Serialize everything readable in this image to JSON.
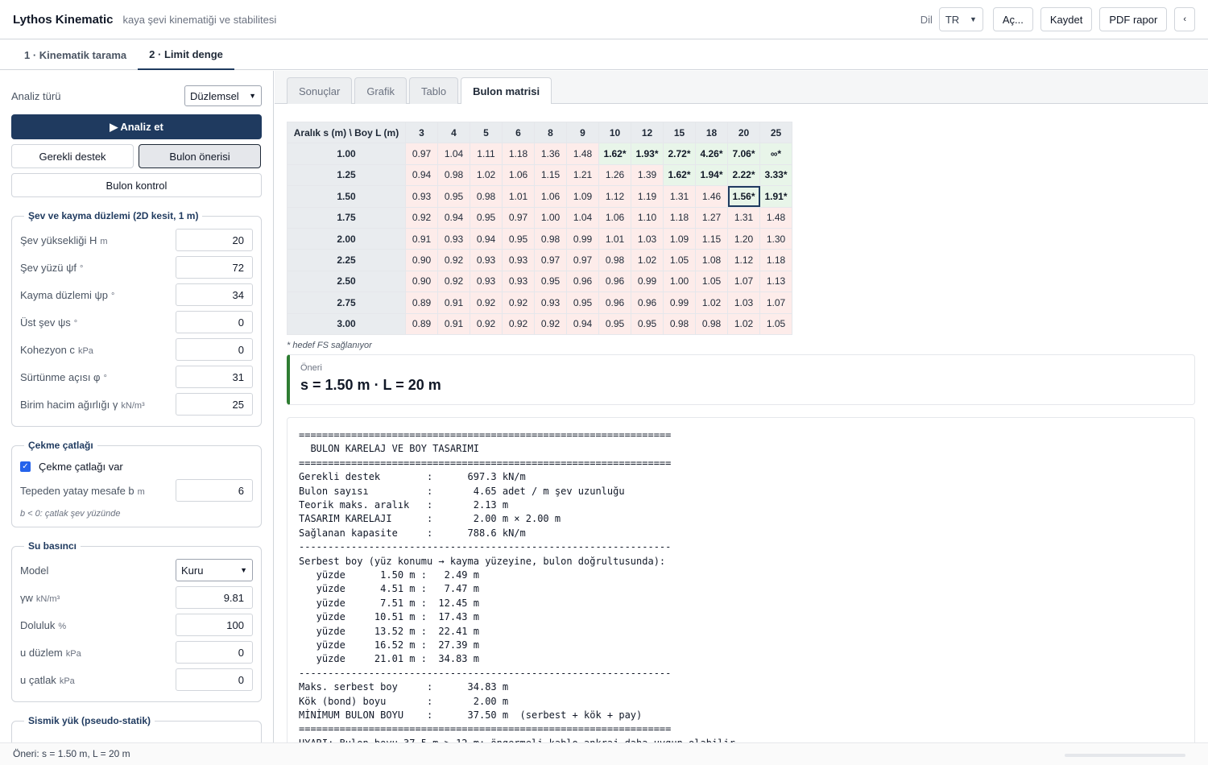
{
  "app": {
    "title": "Lythos Kinematic",
    "subtitle": "kaya şevi kinematiği ve stabilitesi"
  },
  "topbar": {
    "dil_label": "Dil",
    "lang": "TR",
    "open": "Aç...",
    "save": "Kaydet",
    "pdf": "PDF rapor",
    "collapse": "‹"
  },
  "main_tabs": [
    "1 · Kinematik tarama",
    "2 · Limit denge"
  ],
  "sidebar": {
    "analiz_label": "Analiz türü",
    "analiz_value": "Düzlemsel",
    "analyze_btn": "▶ Analiz et",
    "btn_destek": "Gerekli destek",
    "btn_bulon_oneri": "Bulon önerisi",
    "btn_bulon_kontrol": "Bulon kontrol",
    "sev": {
      "legend": "Şev ve kayma düzlemi (2D kesit, 1 m)",
      "fields": [
        {
          "label": "Şev yüksekliği H",
          "unit": "m",
          "value": "20"
        },
        {
          "label": "Şev yüzü ψf",
          "unit": "°",
          "value": "72"
        },
        {
          "label": "Kayma düzlemi ψp",
          "unit": "°",
          "value": "34"
        },
        {
          "label": "Üst şev ψs",
          "unit": "°",
          "value": "0"
        },
        {
          "label": "Kohezyon c",
          "unit": "kPa",
          "value": "0"
        },
        {
          "label": "Sürtünme açısı φ",
          "unit": "°",
          "value": "31"
        },
        {
          "label": "Birim hacim ağırlığı γ",
          "unit": "kN/m³",
          "value": "25"
        }
      ]
    },
    "catlak": {
      "legend": "Çekme çatlağı",
      "checkbox_label": "Çekme çatlağı var",
      "field": {
        "label": "Tepeden yatay mesafe b",
        "unit": "m",
        "value": "6"
      },
      "note": "b < 0: çatlak şev yüzünde"
    },
    "su": {
      "legend": "Su basıncı",
      "model_label": "Model",
      "model_value": "Kuru",
      "fields": [
        {
          "label": "γw",
          "unit": "kN/m³",
          "value": "9.81"
        },
        {
          "label": "Doluluk",
          "unit": "%",
          "value": "100"
        },
        {
          "label": "u düzlem",
          "unit": "kPa",
          "value": "0"
        },
        {
          "label": "u çatlak",
          "unit": "kPa",
          "value": "0"
        }
      ]
    },
    "sismik": {
      "legend": "Sismik yük (pseudo-statik)"
    }
  },
  "sub_tabs": [
    "Sonuçlar",
    "Grafik",
    "Tablo",
    "Bulon matrisi"
  ],
  "matrix": {
    "corner": "Aralık s (m) \\ Boy L (m)",
    "cols": [
      "3",
      "4",
      "5",
      "6",
      "8",
      "9",
      "10",
      "12",
      "15",
      "18",
      "20",
      "25"
    ],
    "rows": [
      {
        "s": "1.00",
        "cells": [
          "0.97",
          "1.04",
          "1.11",
          "1.18",
          "1.36",
          "1.48",
          "1.62*",
          "1.93*",
          "2.72*",
          "4.26*",
          "7.06*",
          "∞*"
        ]
      },
      {
        "s": "1.25",
        "cells": [
          "0.94",
          "0.98",
          "1.02",
          "1.06",
          "1.15",
          "1.21",
          "1.26",
          "1.39",
          "1.62*",
          "1.94*",
          "2.22*",
          "3.33*"
        ]
      },
      {
        "s": "1.50",
        "cells": [
          "0.93",
          "0.95",
          "0.98",
          "1.01",
          "1.06",
          "1.09",
          "1.12",
          "1.19",
          "1.31",
          "1.46",
          "1.56*",
          "1.91*"
        ]
      },
      {
        "s": "1.75",
        "cells": [
          "0.92",
          "0.94",
          "0.95",
          "0.97",
          "1.00",
          "1.04",
          "1.06",
          "1.10",
          "1.18",
          "1.27",
          "1.31",
          "1.48"
        ]
      },
      {
        "s": "2.00",
        "cells": [
          "0.91",
          "0.93",
          "0.94",
          "0.95",
          "0.98",
          "0.99",
          "1.01",
          "1.03",
          "1.09",
          "1.15",
          "1.20",
          "1.30"
        ]
      },
      {
        "s": "2.25",
        "cells": [
          "0.90",
          "0.92",
          "0.93",
          "0.93",
          "0.97",
          "0.97",
          "0.98",
          "1.02",
          "1.05",
          "1.08",
          "1.12",
          "1.18"
        ]
      },
      {
        "s": "2.50",
        "cells": [
          "0.90",
          "0.92",
          "0.93",
          "0.93",
          "0.95",
          "0.96",
          "0.96",
          "0.99",
          "1.00",
          "1.05",
          "1.07",
          "1.13"
        ]
      },
      {
        "s": "2.75",
        "cells": [
          "0.89",
          "0.91",
          "0.92",
          "0.92",
          "0.93",
          "0.95",
          "0.96",
          "0.96",
          "0.99",
          "1.02",
          "1.03",
          "1.07"
        ]
      },
      {
        "s": "3.00",
        "cells": [
          "0.89",
          "0.91",
          "0.92",
          "0.92",
          "0.92",
          "0.94",
          "0.95",
          "0.95",
          "0.98",
          "0.98",
          "1.02",
          "1.05"
        ]
      }
    ],
    "note": "* hedef FS sağlanıyor",
    "colors": {
      "ok": "#e8f5e9",
      "fail": "#fdecea",
      "header": "#e9ecef",
      "best_outline": "#1f3a5f"
    }
  },
  "recommendation": {
    "label": "Öneri",
    "value": "s = 1.50 m · L = 20 m"
  },
  "report_lines": [
    "================================================================",
    "  BULON KARELAJ VE BOY TASARIMI",
    "================================================================",
    "Gerekli destek        :      697.3 kN/m",
    "Bulon sayısı          :       4.65 adet / m şev uzunluğu",
    "Teorik maks. aralık   :       2.13 m",
    "TASARIM KARELAJI      :       2.00 m × 2.00 m",
    "Sağlanan kapasite     :      788.6 kN/m",
    "----------------------------------------------------------------",
    "Serbest boy (yüz konumu → kayma yüzeyine, bulon doğrultusunda):",
    "   yüzde      1.50 m :   2.49 m",
    "   yüzde      4.51 m :   7.47 m",
    "   yüzde      7.51 m :  12.45 m",
    "   yüzde     10.51 m :  17.43 m",
    "   yüzde     13.52 m :  22.41 m",
    "   yüzde     16.52 m :  27.39 m",
    "   yüzde     21.01 m :  34.83 m",
    "----------------------------------------------------------------",
    "Maks. serbest boy     :      34.83 m",
    "Kök (bond) boyu       :       2.00 m",
    "MİNİMUM BULON BOYU    :      37.50 m  (serbest + kök + pay)",
    "================================================================",
    "UYARI: Bulon boyu 37.5 m > 12 m: öngermeli kablo ankraj daha uygun olabilir."
  ],
  "status": "Öneri: s = 1.50 m, L = 20 m"
}
